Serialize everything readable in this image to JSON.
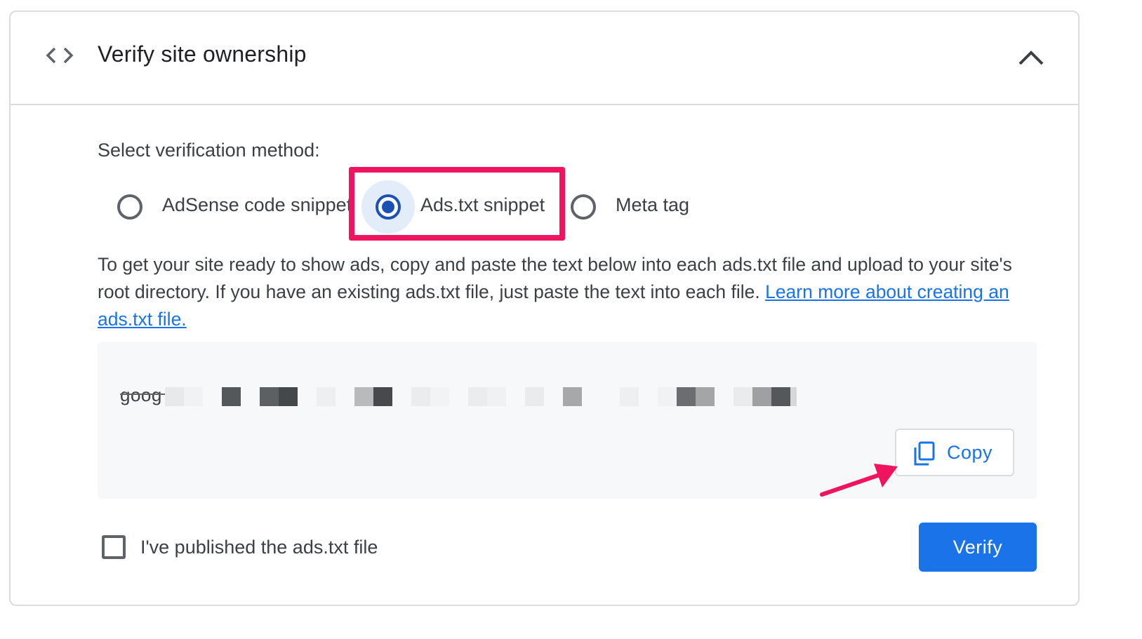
{
  "section": {
    "title": "Verify site ownership",
    "icon": "code-brackets-icon",
    "collapse_icon": "chevron-up-icon"
  },
  "verification": {
    "label": "Select verification method:",
    "options": [
      {
        "label": "AdSense code snippet",
        "selected": false
      },
      {
        "label": "Ads.txt snippet",
        "selected": true
      },
      {
        "label": "Meta tag",
        "selected": false
      }
    ],
    "selected_color": "#1a52b4"
  },
  "description": {
    "text": "To get your site ready to show ads, copy and paste the text below into each ads.txt file and upload to your site's root directory. If you have an existing ads.txt file, just paste the text into each file. ",
    "link_text": "Learn more about creating an ads.txt file."
  },
  "snippet": {
    "visible_text": "goog",
    "redacted": true
  },
  "copy_button": {
    "label": "Copy",
    "icon": "copy-icon"
  },
  "published_checkbox": {
    "label": "I've published the ads.txt file",
    "checked": false
  },
  "verify_button": {
    "label": "Verify"
  },
  "annotation": {
    "highlight_color": "#f0135f"
  },
  "colors": {
    "accent": "#1a73e8",
    "border": "#dadce0",
    "text": "#3c4043"
  }
}
